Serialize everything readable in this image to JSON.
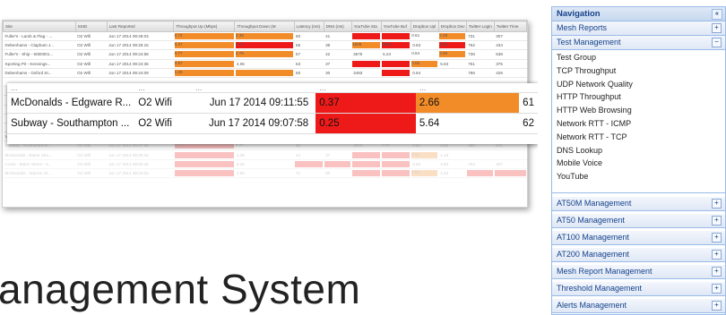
{
  "colors": {
    "red": "#ee1a1a",
    "orange": "#f28c28",
    "nav_border": "#99bbe8",
    "nav_text": "#15428b"
  },
  "back_table": {
    "headers": [
      "Site",
      "SSID",
      "Last Reported",
      "Throughput Up (Mbps)",
      "Throughput Down (M",
      "Latency (ms)",
      "DNS (ms)",
      "YouTube Sta",
      "YouTube Buf",
      "Dropbox Upl",
      "Dropbox Dov",
      "Twitter Login",
      "Twitter Time"
    ],
    "rows": [
      [
        "Fuller's - Lamb & Flag - ...",
        "O2 Wifi",
        "Jun 17 2014 09:26:03",
        "0.72",
        "2.38",
        "60",
        "41",
        "",
        "",
        "0.61",
        "2.48",
        "731",
        "307"
      ],
      [
        "Debenhams - Clapham J...",
        "O2 Wifi",
        "Jun 17 2014 09:25:15",
        "0.47",
        "3.47",
        "65",
        "38",
        "4608",
        "6883",
        "0.63",
        "3.68",
        "762",
        "434"
      ],
      [
        "Fuller's - Ship - 5000001...",
        "O2 Wifi",
        "Jun 17 2014 09:24:58",
        "0.77",
        "2.79",
        "57",
        "42",
        "3575",
        "5.24",
        "0.64",
        "2.69",
        "736",
        "538"
      ],
      [
        "Sporting Pit - Kennings...",
        "O2 Wifi",
        "Jun 17 2014 09:24:36",
        "0.67",
        "4.06",
        "63",
        "37",
        "",
        "",
        "0.56",
        "5.63",
        "751",
        "375"
      ],
      [
        "Debenhams - Oxford St...",
        "O2 Wifi",
        "Jun 17 2014 09:24:09",
        "1.25",
        "",
        "60",
        "30",
        "3493",
        "",
        "0.64",
        "",
        "786",
        "426"
      ]
    ],
    "faded_rows": [
      [
        "McDonalds - Edgware R...",
        "O2 Wifi",
        "Jun 17 2014 09:11:55",
        "0.37",
        "2.66",
        "61",
        "42",
        "2101",
        "6.55",
        "0.62",
        "4.83",
        "",
        "621"
      ],
      [
        "Subway - Southampton ...",
        "O2 Wifi",
        "Jun 17 2014 09:07:58",
        "0.25",
        "5.64",
        "62",
        "",
        "1974",
        "6.91",
        "0.61",
        "4.62",
        "460",
        "641"
      ],
      [
        "McDonalds - Baker Stre...",
        "O2 Wifi",
        "Jun 17 2014 09:06:42",
        "",
        "3.38",
        "42",
        "37",
        "",
        "",
        "0.61",
        "1.43",
        "",
        ""
      ],
      [
        "Costa - Baker Street - 5...",
        "O2 Wifi",
        "Jun 17 2014 09:05:36",
        "",
        "6.30",
        "",
        "",
        "",
        "",
        "0.60",
        "4.83",
        "794",
        "467"
      ],
      [
        "McDonalds - Warren St...",
        "O2 Wifi",
        "Jun 17 2014 09:04:03",
        "",
        "3.98",
        "71",
        "90",
        "",
        "",
        "0.63",
        "4.43",
        "",
        ""
      ]
    ]
  },
  "front_table": {
    "partial_row": [
      "...",
      "...",
      "...",
      "...",
      "..."
    ],
    "rows": [
      {
        "site": "McDonalds - Edgware R...",
        "ssid": "O2 Wifi",
        "last": "Jun 17 2014 09:11:55",
        "up": "0.37",
        "down": "2.66",
        "extra": "61"
      },
      {
        "site": "Subway - Southampton ...",
        "ssid": "O2 Wifi",
        "last": "Jun 17 2014 09:07:58",
        "up": "0.25",
        "down": "5.64",
        "extra": "62"
      }
    ]
  },
  "hero": {
    "title": "anagement System"
  },
  "nav": {
    "title": "Navigation",
    "collapse_glyph": "«",
    "sections_top": [
      {
        "label": "Mesh Reports",
        "tool": "+"
      },
      {
        "label": "Test Management",
        "tool": "−"
      }
    ],
    "test_items": [
      "Test Group",
      "TCP Throughput",
      "UDP Network Quality",
      "HTTP Throughput",
      "HTTP Web Browsing",
      "Network RTT - ICMP",
      "Network RTT - TCP",
      "DNS Lookup",
      "Mobile Voice",
      "YouTube"
    ],
    "sections_bottom": [
      {
        "label": "AT50M Management",
        "tool": "+"
      },
      {
        "label": "AT50 Management",
        "tool": "+"
      },
      {
        "label": "AT100 Management",
        "tool": "+"
      },
      {
        "label": "AT200 Management",
        "tool": "+"
      },
      {
        "label": "Mesh Report Management",
        "tool": "+"
      },
      {
        "label": "Threshold Management",
        "tool": "+"
      },
      {
        "label": "Alerts Management",
        "tool": "+"
      }
    ]
  }
}
